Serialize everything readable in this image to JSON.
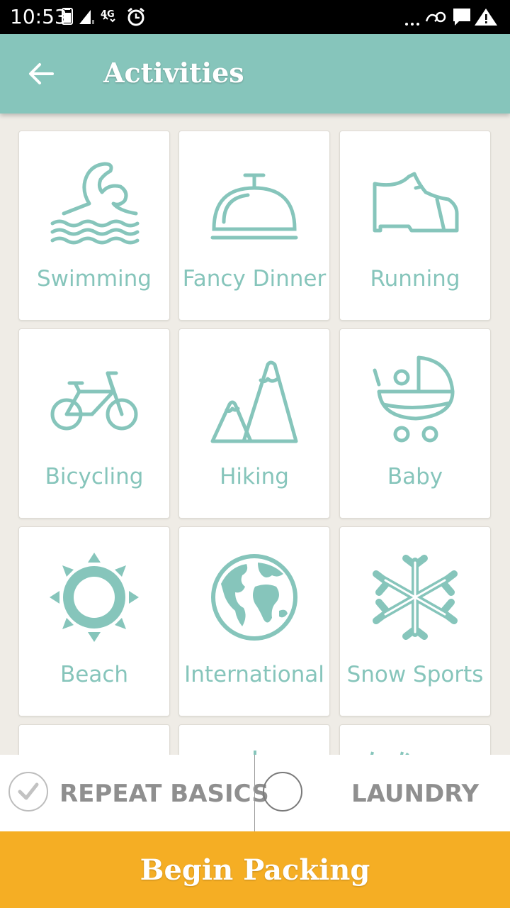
{
  "status_bar": {
    "time": "10:53",
    "network": "4G",
    "overflow": "...",
    "icons": [
      "battery-icon",
      "signal-icon",
      "network-4g-icon",
      "alarm-icon",
      "wifi-calling-icon",
      "message-icon",
      "warning-icon"
    ]
  },
  "app_bar": {
    "title": "Activities",
    "back_icon": "arrow-left-icon"
  },
  "activities": [
    {
      "label": "Swimming",
      "icon": "swimming-icon"
    },
    {
      "label": "Fancy Dinner",
      "icon": "cloche-icon"
    },
    {
      "label": "Running",
      "icon": "shoe-icon"
    },
    {
      "label": "Bicycling",
      "icon": "bicycle-icon"
    },
    {
      "label": "Hiking",
      "icon": "mountain-icon"
    },
    {
      "label": "Baby",
      "icon": "stroller-icon"
    },
    {
      "label": "Beach",
      "icon": "sun-icon"
    },
    {
      "label": "International",
      "icon": "globe-icon"
    },
    {
      "label": "Snow Sports",
      "icon": "snowflake-icon"
    }
  ],
  "options": {
    "repeat_basics": {
      "label": "REPEAT BASICS",
      "checked": true
    },
    "laundry": {
      "label": "LAUNDRY",
      "checked": false
    }
  },
  "begin_button": {
    "label": "Begin Packing"
  },
  "colors": {
    "accent": "#86c5bb",
    "app_bar": "#86c5bb",
    "primary_button": "#f5ae24",
    "background": "#efece6"
  }
}
